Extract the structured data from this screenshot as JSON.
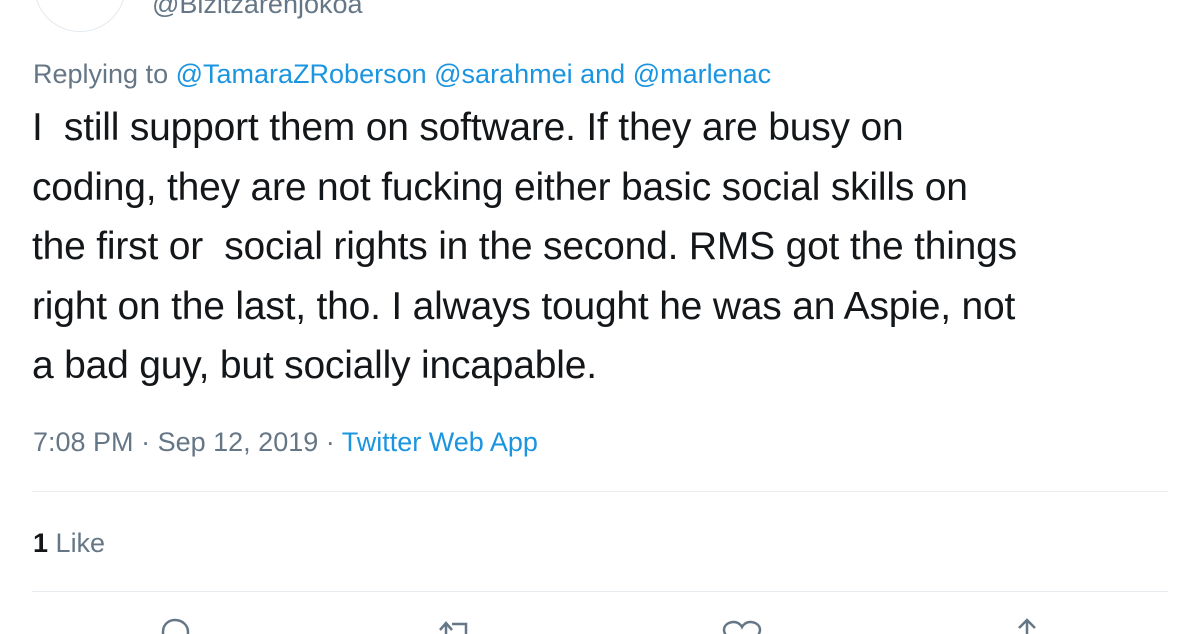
{
  "author": {
    "handle": "@Bizitzarenjokoa"
  },
  "reply_context": {
    "prefix": "Replying to",
    "mention_1": "@TamaraZRoberson",
    "mention_2": "@sarahmei",
    "conjunction": "and",
    "mention_3": "@marlenac"
  },
  "tweet": {
    "line_1": "I  still support them on software. If they are busy on",
    "line_2": "coding, they are not fucking either basic social skills on",
    "line_3": "the first or  social rights in the second. RMS got the things",
    "line_4": "right on the last, tho. I always tought he was an Aspie, not",
    "line_5": "a bad guy, but socially incapable."
  },
  "meta": {
    "time": "7:08 PM",
    "separator": "·",
    "date": "Sep 12, 2019",
    "source": "Twitter Web App"
  },
  "stats": {
    "likes_count": "1",
    "likes_label": "Like"
  },
  "actions": {
    "reply_icon": "reply-icon",
    "retweet_icon": "retweet-icon",
    "like_icon": "heart-icon",
    "share_icon": "share-icon"
  },
  "colors": {
    "link": "#1b95e0",
    "secondary_text": "#657786",
    "primary_text": "#14171a",
    "divider": "#e6ecf0"
  }
}
